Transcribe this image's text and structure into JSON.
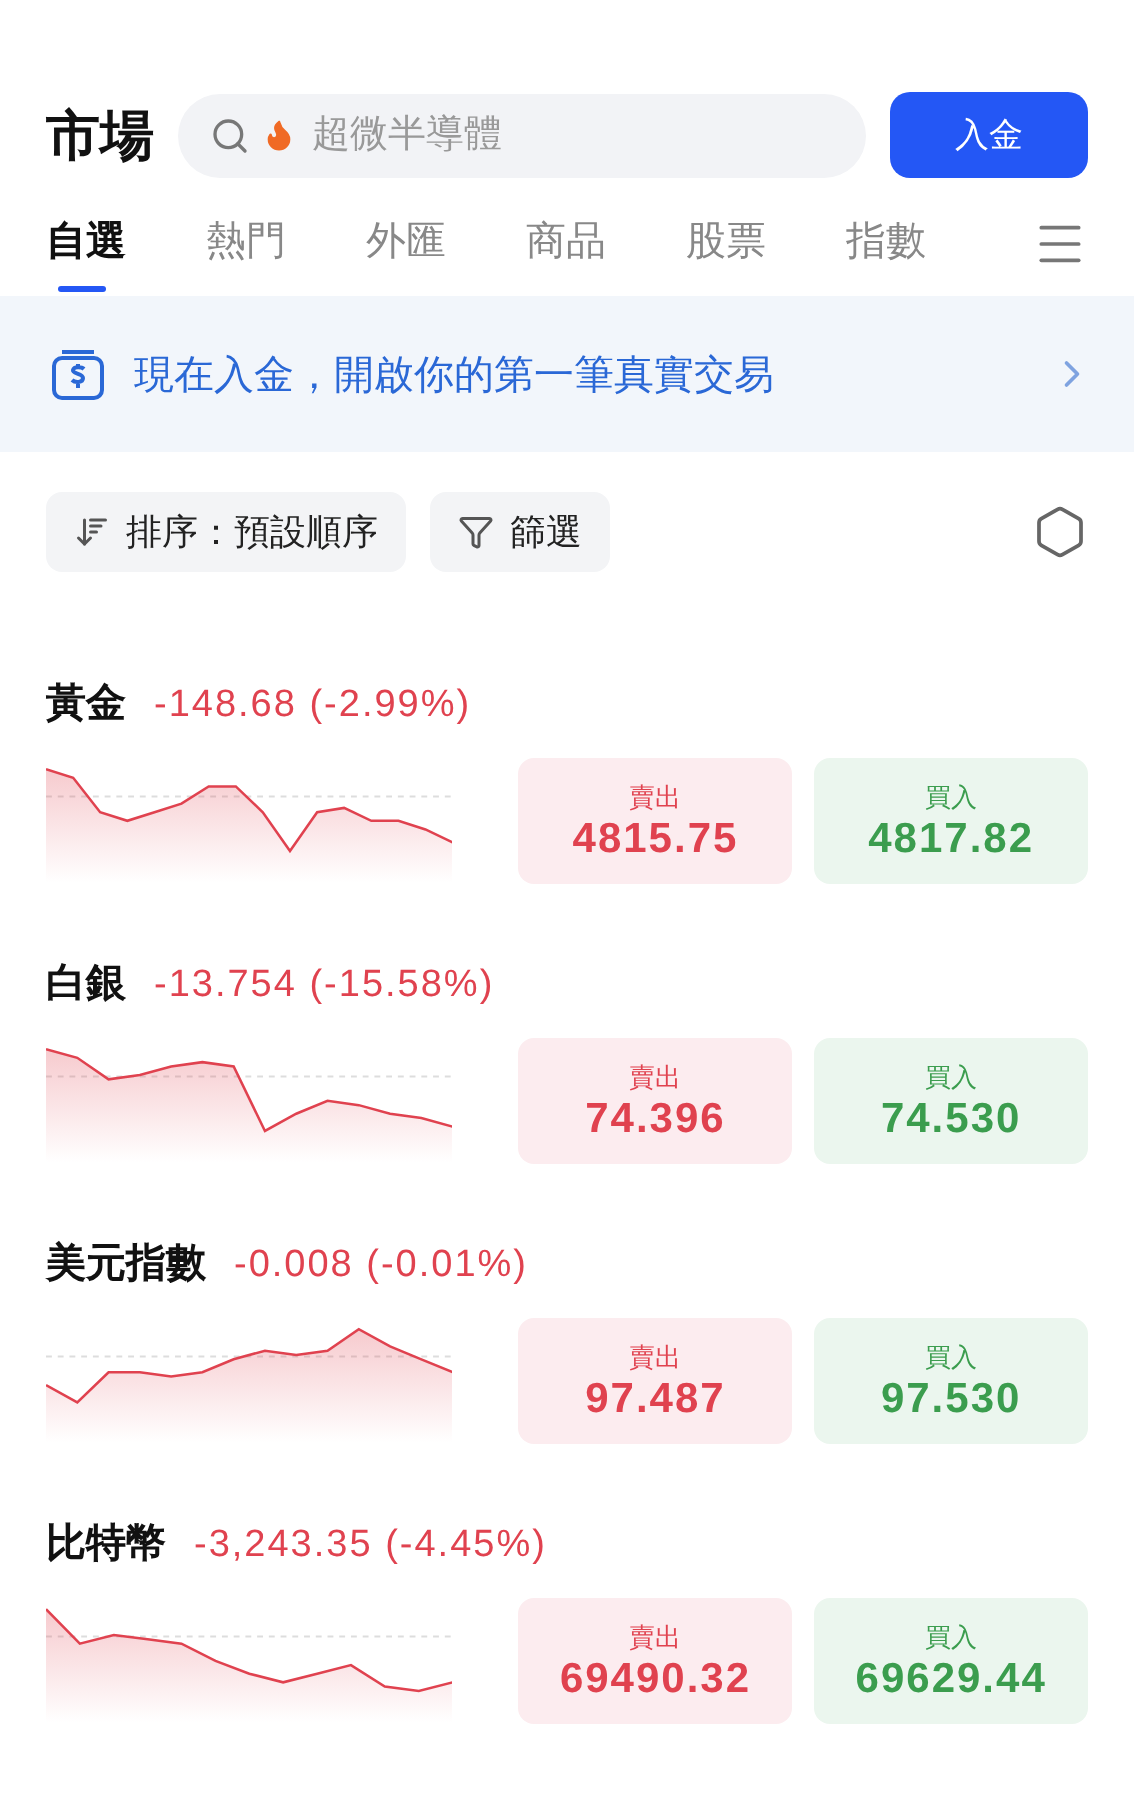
{
  "header": {
    "title": "市場",
    "search": {
      "placeholder": "超微半導體"
    },
    "deposit_button": "入金"
  },
  "tabs": [
    {
      "label": "自選",
      "selected": true
    },
    {
      "label": "熱門",
      "selected": false
    },
    {
      "label": "外匯",
      "selected": false
    },
    {
      "label": "商品",
      "selected": false
    },
    {
      "label": "股票",
      "selected": false
    },
    {
      "label": "指數",
      "selected": false
    }
  ],
  "banner": {
    "text": "現在入金，開啟你的第一筆真實交易"
  },
  "toolbar": {
    "sort": "排序：預設順序",
    "filter": "篩選"
  },
  "instruments": [
    {
      "name": "黃金",
      "change": "-148.68 (-2.99%)",
      "sell_label": "賣出",
      "sell": "4815.75",
      "buy_label": "買入",
      "buy": "4817.82"
    },
    {
      "name": "白銀",
      "change": "-13.754 (-15.58%)",
      "sell_label": "賣出",
      "sell": "74.396",
      "buy_label": "買入",
      "buy": "74.530"
    },
    {
      "name": "美元指數",
      "change": "-0.008 (-0.01%)",
      "sell_label": "賣出",
      "sell": "97.487",
      "buy_label": "買入",
      "buy": "97.530"
    },
    {
      "name": "比特幣",
      "change": "-3,243.35 (-4.45%)",
      "sell_label": "賣出",
      "sell": "69490.32",
      "buy_label": "買入",
      "buy": "69629.44"
    }
  ]
}
